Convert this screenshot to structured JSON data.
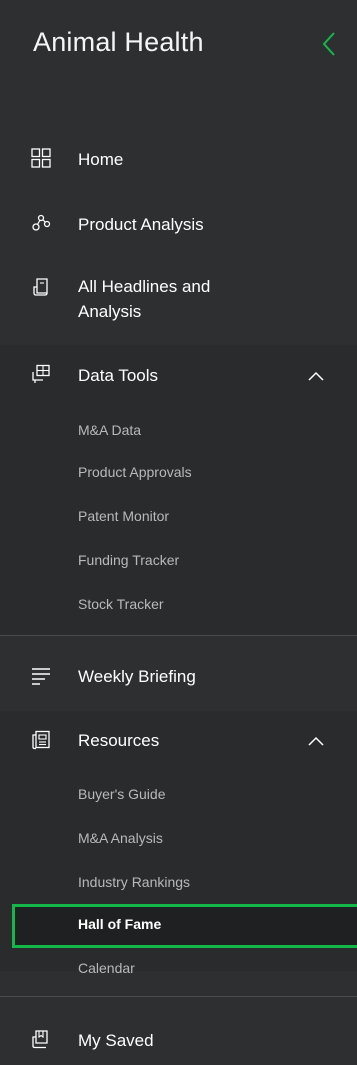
{
  "app": {
    "title": "Animal Health"
  },
  "nav": {
    "home": "Home",
    "product_analysis": "Product Analysis",
    "all_headlines_line1": "All Headlines and",
    "all_headlines_line2": "Analysis",
    "data_tools": {
      "label": "Data Tools",
      "items": [
        "M&A Data",
        "Product Approvals",
        "Patent Monitor",
        "Funding Tracker",
        "Stock Tracker"
      ]
    },
    "weekly_briefing": "Weekly Briefing",
    "resources": {
      "label": "Resources",
      "items": [
        "Buyer's Guide",
        "M&A Analysis",
        "Industry Rankings",
        "Hall of Fame",
        "Calendar"
      ],
      "active": "Hall of Fame"
    },
    "my_saved": "My Saved"
  },
  "colors": {
    "accent": "#14b84a",
    "background": "#2e2f31",
    "submenu_bg": "#2a2b2d",
    "sub_text": "#b8b9bb"
  }
}
